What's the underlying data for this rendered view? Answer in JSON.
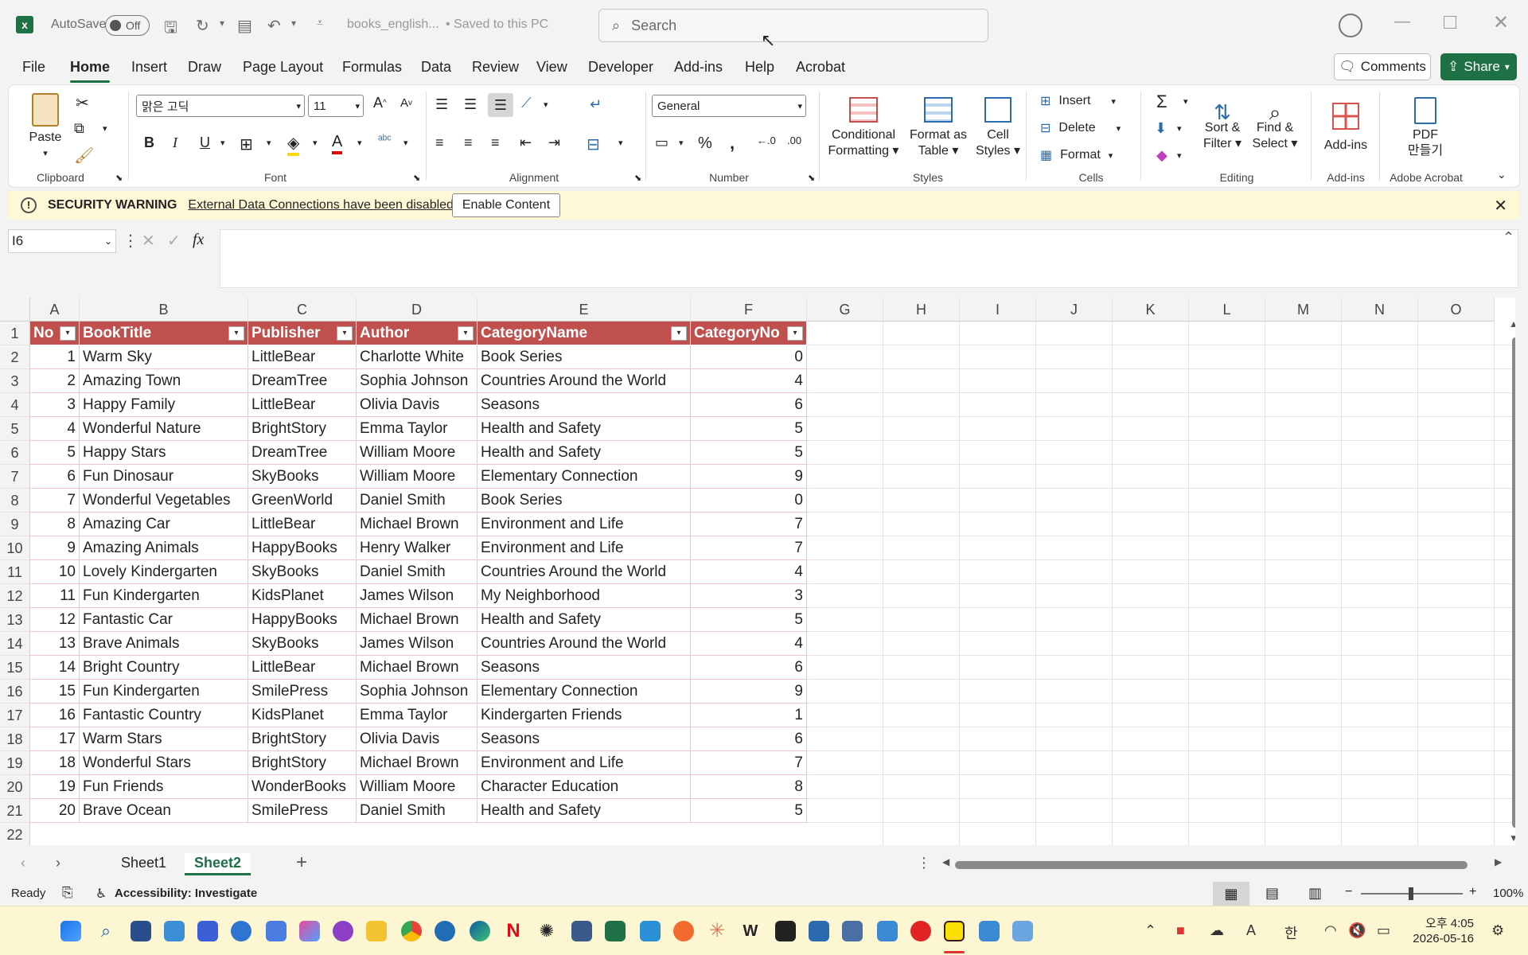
{
  "titlebar": {
    "autosave_label": "AutoSave",
    "autosave_state": "Off",
    "filename": "books_english...",
    "save_status": "• Saved to this PC",
    "search_placeholder": "Search"
  },
  "menu": {
    "tabs": [
      "File",
      "Home",
      "Insert",
      "Draw",
      "Page Layout",
      "Formulas",
      "Data",
      "Review",
      "View",
      "Developer",
      "Add-ins",
      "Help",
      "Acrobat"
    ],
    "active": "Home",
    "comments_label": "Comments",
    "share_label": "Share"
  },
  "ribbon": {
    "clipboard": {
      "label": "Clipboard",
      "paste": "Paste"
    },
    "font": {
      "label": "Font",
      "font_name": "맑은 고딕",
      "font_size": "11"
    },
    "alignment": {
      "label": "Alignment"
    },
    "number": {
      "label": "Number",
      "format": "General"
    },
    "styles": {
      "label": "Styles",
      "conditional": "Conditional",
      "conditional2": "Formatting",
      "format_table": "Format as",
      "format_table2": "Table",
      "cell_styles": "Cell",
      "cell_styles2": "Styles"
    },
    "cells": {
      "label": "Cells",
      "insert": "Insert",
      "delete": "Delete",
      "format": "Format"
    },
    "editing": {
      "label": "Editing",
      "sort": "Sort &",
      "sort2": "Filter",
      "find": "Find &",
      "find2": "Select"
    },
    "addins": {
      "label": "Add-ins",
      "button": "Add-ins"
    },
    "acrobat": {
      "label": "Adobe Acrobat",
      "button": "PDF",
      "button2": "만들기"
    }
  },
  "security": {
    "title": "SECURITY WARNING",
    "message": "External Data Connections have been disabled",
    "button": "Enable Content"
  },
  "formula_bar": {
    "cell_ref": "I6",
    "fx": "fx",
    "value": ""
  },
  "sheet": {
    "columns": [
      "A",
      "B",
      "C",
      "D",
      "E",
      "F",
      "G",
      "H",
      "I",
      "J",
      "K",
      "L",
      "M",
      "N",
      "O"
    ],
    "headers": [
      "No",
      "BookTitle",
      "Publisher",
      "Author",
      "CategoryName",
      "CategoryNo"
    ],
    "rows": [
      [
        "1",
        "Warm Sky",
        "LittleBear",
        "Charlotte White",
        "Book Series",
        "0"
      ],
      [
        "2",
        "Amazing Town",
        "DreamTree",
        "Sophia Johnson",
        "Countries Around the World",
        "4"
      ],
      [
        "3",
        "Happy Family",
        "LittleBear",
        "Olivia Davis",
        "Seasons",
        "6"
      ],
      [
        "4",
        "Wonderful Nature",
        "BrightStory",
        "Emma Taylor",
        "Health and Safety",
        "5"
      ],
      [
        "5",
        "Happy Stars",
        "DreamTree",
        "William Moore",
        "Health and Safety",
        "5"
      ],
      [
        "6",
        "Fun Dinosaur",
        "SkyBooks",
        "William Moore",
        "Elementary Connection",
        "9"
      ],
      [
        "7",
        "Wonderful Vegetables",
        "GreenWorld",
        "Daniel Smith",
        "Book Series",
        "0"
      ],
      [
        "8",
        "Amazing Car",
        "LittleBear",
        "Michael Brown",
        "Environment and Life",
        "7"
      ],
      [
        "9",
        "Amazing Animals",
        "HappyBooks",
        "Henry Walker",
        "Environment and Life",
        "7"
      ],
      [
        "10",
        "Lovely Kindergarten",
        "SkyBooks",
        "Daniel Smith",
        "Countries Around the World",
        "4"
      ],
      [
        "11",
        "Fun Kindergarten",
        "KidsPlanet",
        "James Wilson",
        "My Neighborhood",
        "3"
      ],
      [
        "12",
        "Fantastic Car",
        "HappyBooks",
        "Michael Brown",
        "Health and Safety",
        "5"
      ],
      [
        "13",
        "Brave Animals",
        "SkyBooks",
        "James Wilson",
        "Countries Around the World",
        "4"
      ],
      [
        "14",
        "Bright Country",
        "LittleBear",
        "Michael Brown",
        "Seasons",
        "6"
      ],
      [
        "15",
        "Fun Kindergarten",
        "SmilePress",
        "Sophia Johnson",
        "Elementary Connection",
        "9"
      ],
      [
        "16",
        "Fantastic Country",
        "KidsPlanet",
        "Emma Taylor",
        "Kindergarten Friends",
        "1"
      ],
      [
        "17",
        "Warm Stars",
        "BrightStory",
        "Olivia Davis",
        "Seasons",
        "6"
      ],
      [
        "18",
        "Wonderful Stars",
        "BrightStory",
        "Michael Brown",
        "Environment and Life",
        "7"
      ],
      [
        "19",
        "Fun Friends",
        "WonderBooks",
        "William Moore",
        "Character Education",
        "8"
      ],
      [
        "20",
        "Brave Ocean",
        "SmilePress",
        "Daniel Smith",
        "Health and Safety",
        "5"
      ]
    ],
    "row_numbers": [
      "1",
      "2",
      "3",
      "4",
      "5",
      "6",
      "7",
      "8",
      "9",
      "10",
      "11",
      "12",
      "13",
      "14",
      "15",
      "16",
      "17",
      "18",
      "19",
      "20",
      "21",
      "22"
    ],
    "tabs": [
      "Sheet1",
      "Sheet2"
    ],
    "active_tab": "Sheet2"
  },
  "status": {
    "ready": "Ready",
    "accessibility": "Accessibility: Investigate",
    "zoom": "100%"
  },
  "taskbar": {
    "time": "오후 4:05",
    "date": "2026-05-16",
    "ime": "한"
  },
  "colors": {
    "accent": "#1e7145",
    "table_header": "#c0504d",
    "table_border": "#f0c6c6",
    "warning_bg": "#fff8d6"
  }
}
